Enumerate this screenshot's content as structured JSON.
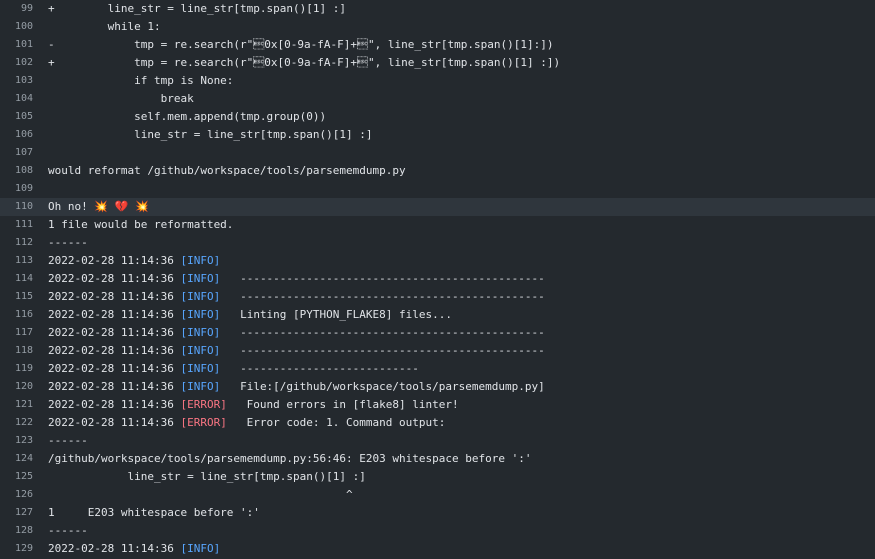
{
  "colors": {
    "background": "#24292e",
    "highlight_row": "#2f363d",
    "line_number": "#959da5",
    "text": "#e1e4e8",
    "info": "#58a6ff",
    "error": "#f97583"
  },
  "highlighted_line": 110,
  "lines": [
    {
      "n": "99",
      "text": "+        line_str = line_str[tmp.span()[1] :]"
    },
    {
      "n": "100",
      "text": "         while 1:"
    },
    {
      "n": "101",
      "text": "-            tmp = re.search(r\"\u001b0x[0-9a-fA-F]+\u001b\", line_str[tmp.span()[1]:])"
    },
    {
      "n": "102",
      "text": "+            tmp = re.search(r\"\u001b0x[0-9a-fA-F]+\u001b\", line_str[tmp.span()[1] :])"
    },
    {
      "n": "103",
      "text": "             if tmp is None:"
    },
    {
      "n": "104",
      "text": "                 break"
    },
    {
      "n": "105",
      "text": "             self.mem.append(tmp.group(0))"
    },
    {
      "n": "106",
      "text": "             line_str = line_str[tmp.span()[1] :]"
    },
    {
      "n": "107",
      "text": ""
    },
    {
      "n": "108",
      "text": "would reformat /github/workspace/tools/parsememdump.py"
    },
    {
      "n": "109",
      "text": ""
    },
    {
      "n": "110",
      "text": "Oh no! 💥 💔 💥"
    },
    {
      "n": "111",
      "text": "1 file would be reformatted."
    },
    {
      "n": "112",
      "text": "------"
    },
    {
      "n": "113",
      "ts": "2022-02-28 11:14:36",
      "level": "[INFO]",
      "msg": ""
    },
    {
      "n": "114",
      "ts": "2022-02-28 11:14:36",
      "level": "[INFO]",
      "msg": "   ----------------------------------------------"
    },
    {
      "n": "115",
      "ts": "2022-02-28 11:14:36",
      "level": "[INFO]",
      "msg": "   ----------------------------------------------"
    },
    {
      "n": "116",
      "ts": "2022-02-28 11:14:36",
      "level": "[INFO]",
      "msg": "   Linting [PYTHON_FLAKE8] files..."
    },
    {
      "n": "117",
      "ts": "2022-02-28 11:14:36",
      "level": "[INFO]",
      "msg": "   ----------------------------------------------"
    },
    {
      "n": "118",
      "ts": "2022-02-28 11:14:36",
      "level": "[INFO]",
      "msg": "   ----------------------------------------------"
    },
    {
      "n": "119",
      "ts": "2022-02-28 11:14:36",
      "level": "[INFO]",
      "msg": "   ---------------------------"
    },
    {
      "n": "120",
      "ts": "2022-02-28 11:14:36",
      "level": "[INFO]",
      "msg": "   File:[/github/workspace/tools/parsememdump.py]"
    },
    {
      "n": "121",
      "ts": "2022-02-28 11:14:36",
      "level": "[ERROR]",
      "msg": "   Found errors in [flake8] linter!"
    },
    {
      "n": "122",
      "ts": "2022-02-28 11:14:36",
      "level": "[ERROR]",
      "msg": "   Error code: 1. Command output:"
    },
    {
      "n": "123",
      "text": "------"
    },
    {
      "n": "124",
      "text": "/github/workspace/tools/parsememdump.py:56:46: E203 whitespace before ':'"
    },
    {
      "n": "125",
      "text": "            line_str = line_str[tmp.span()[1] :]"
    },
    {
      "n": "126",
      "text": "                                             ^"
    },
    {
      "n": "127",
      "text": "1     E203 whitespace before ':'"
    },
    {
      "n": "128",
      "text": "------"
    },
    {
      "n": "129",
      "ts": "2022-02-28 11:14:36",
      "level": "[INFO]",
      "msg": ""
    }
  ]
}
